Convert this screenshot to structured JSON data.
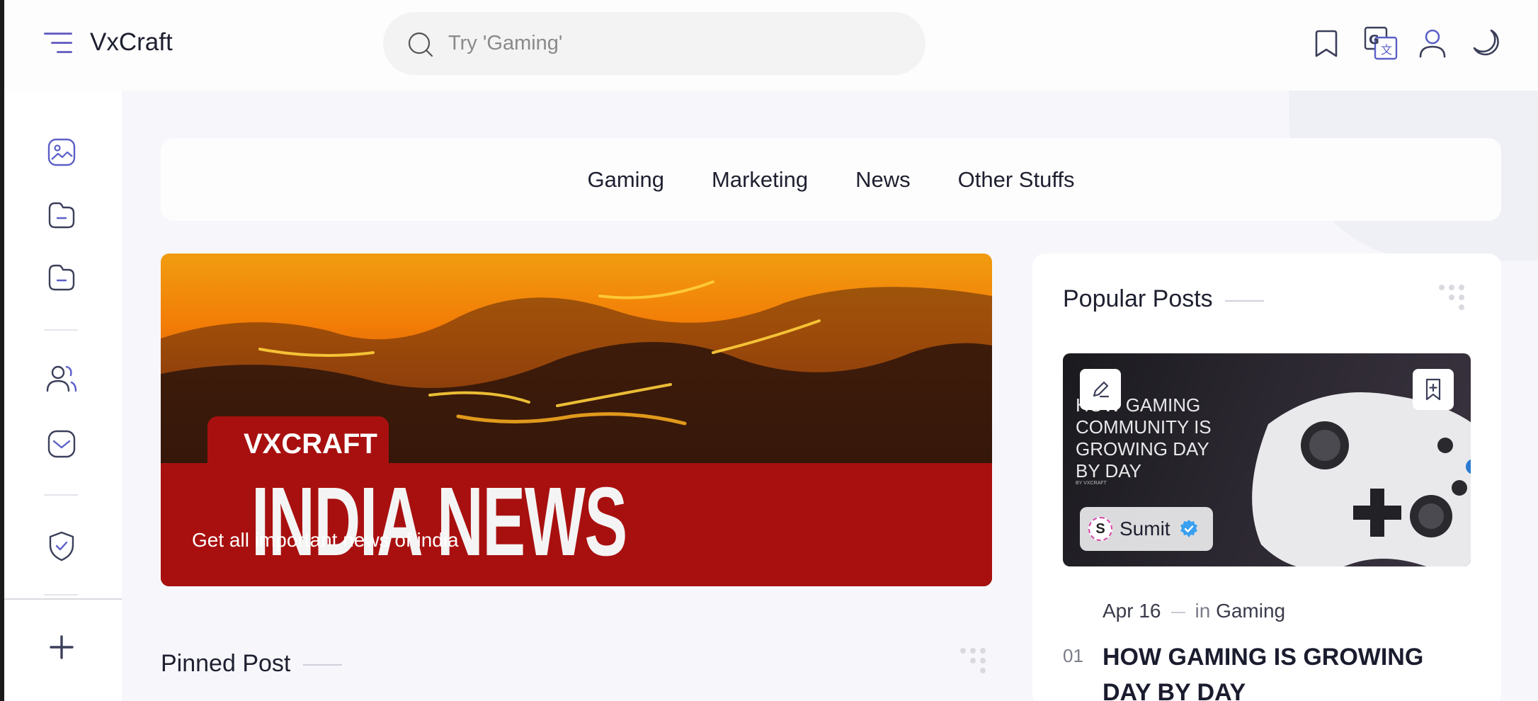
{
  "app": {
    "brand": "VxCraft"
  },
  "search": {
    "placeholder": "Try 'Gaming'"
  },
  "header_icons": [
    "bookmark-icon",
    "translate-icon",
    "user-icon",
    "moon-icon"
  ],
  "sidebar": {
    "items": [
      "gallery-icon",
      "folder-icon",
      "folder-icon",
      "users-icon",
      "inbox-icon",
      "shield-check-icon"
    ],
    "bottom_button": "plus-icon"
  },
  "categories": [
    "Gaming",
    "Marketing",
    "News",
    "Other Stuffs"
  ],
  "hero": {
    "brand_text": "VXCRAFT",
    "title": "INDIA NEWS",
    "caption": "Get all important news of india"
  },
  "pinned": {
    "title": "Pinned Post"
  },
  "popular": {
    "title": "Popular Posts",
    "card": {
      "image_text": "HOW GAMING COMMUNITY IS GROWING DAY BY DAY",
      "image_subtext": "BY VXCRAFT",
      "author": "Sumit",
      "avatar_letter": "S"
    },
    "post": {
      "date": "Apr 16",
      "in_label": "in",
      "category": "Gaming",
      "number": "01",
      "title": "HOW GAMING IS GROWING DAY BY DAY"
    }
  },
  "colors": {
    "accent": "#6a64c4",
    "hero_red": "#a8100f",
    "text": "#1e2030"
  }
}
